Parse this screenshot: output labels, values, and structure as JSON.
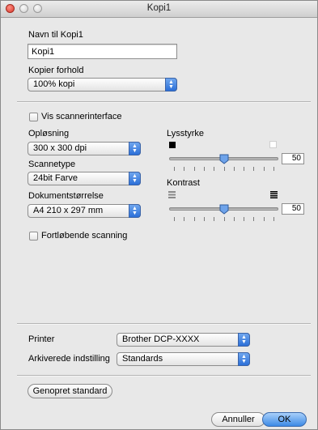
{
  "window": {
    "title": "Kopi1"
  },
  "name_section": {
    "label": "Navn til Kopi1",
    "value": "Kopi1"
  },
  "copy_ratio": {
    "label": "Kopier forhold",
    "value": "100% kopi"
  },
  "scanner_interface": {
    "label": "Vis scannerinterface",
    "checked": false
  },
  "resolution": {
    "label": "Opløsning",
    "value": "300 x 300 dpi"
  },
  "scan_type": {
    "label": "Scannetype",
    "value": "24bit Farve"
  },
  "document_size": {
    "label": "Dokumentstørrelse",
    "value": "A4 210 x 297 mm"
  },
  "continuous_scan": {
    "label": "Fortløbende scanning",
    "checked": false
  },
  "brightness": {
    "label": "Lysstyrke",
    "value": "50",
    "level": 0.5
  },
  "contrast": {
    "label": "Kontrast",
    "value": "50",
    "level": 0.5
  },
  "printer": {
    "label": "Printer",
    "value": "Brother DCP-XXXX"
  },
  "saved_settings": {
    "label": "Arkiverede indstilling",
    "value": "Standards"
  },
  "buttons": {
    "restore": "Genopret standard",
    "cancel": "Annuller",
    "ok": "OK"
  },
  "colors": {
    "accent": "#3c8ae6",
    "close": "#d8382c"
  }
}
